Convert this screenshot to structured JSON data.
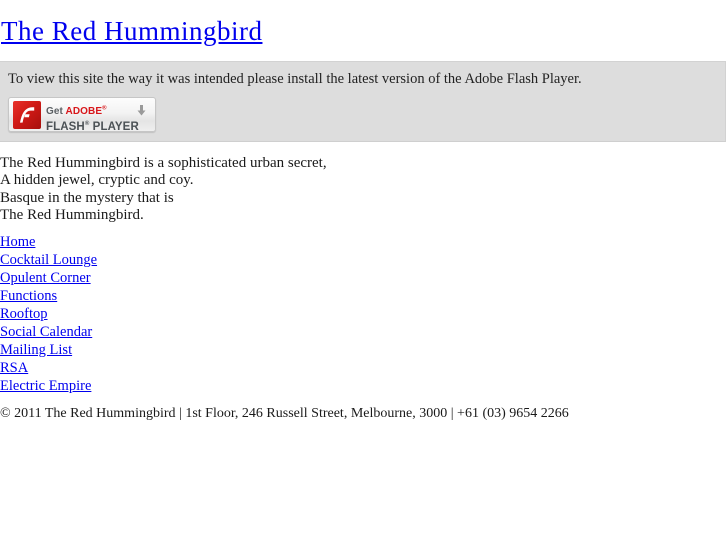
{
  "site": {
    "title": "The Red Hummingbird"
  },
  "flash_notice": {
    "text": "To view this site the way it was intended please install the latest version of the Adobe Flash Player.",
    "background_color": "#dddddd",
    "button": {
      "get_label": "Get",
      "adobe_label": "ADOBE",
      "registered_mark": "®",
      "flash_label": "FLASH",
      "player_label": " PLAYER",
      "logo_letter": "f",
      "logo_color": "#d01a16",
      "adobe_text_color": "#d8161a",
      "arrow_icon": "download-arrow-icon"
    }
  },
  "tagline": {
    "lines": [
      "The Red Hummingbird is a sophisticated urban secret,",
      "A hidden jewel, cryptic and coy.",
      "Basque in the mystery that is",
      "The Red Hummingbird."
    ]
  },
  "navigation": {
    "items": [
      {
        "label": "Home"
      },
      {
        "label": "Cocktail Lounge"
      },
      {
        "label": "Opulent Corner"
      },
      {
        "label": "Functions"
      },
      {
        "label": "Rooftop"
      },
      {
        "label": "Social Calendar"
      },
      {
        "label": "Mailing List"
      },
      {
        "label": "RSA"
      },
      {
        "label": "Electric Empire"
      }
    ],
    "link_color": "#0000ee"
  },
  "footer": {
    "text": "© 2011 The Red Hummingbird | 1st Floor, 246 Russell Street, Melbourne, 3000 | +61 (03) 9654 2266"
  }
}
